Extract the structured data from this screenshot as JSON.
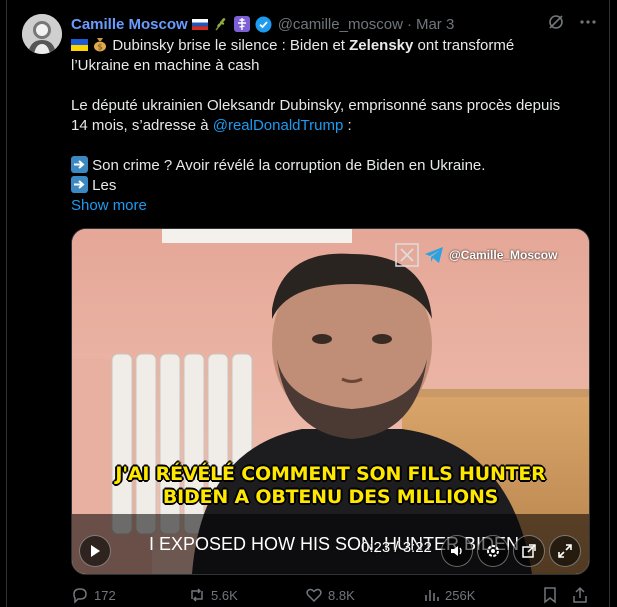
{
  "tweet": {
    "author_name": "Camille Moscow",
    "handle": "@camille_moscow",
    "separator": "·",
    "date": "Mar 3",
    "author_badges": [
      "russia-flag",
      "olive-branch",
      "orthodox-cross",
      "verified-badge"
    ],
    "lines": {
      "l1_a": "Dubinsky brise le silence : Biden et ",
      "l1_bold": "Zelensky",
      "l1_b": " ont transformé",
      "l2": "l’Ukraine en machine à cash",
      "l3": "Le député ukrainien Oleksandr Dubinsky, emprisonné sans procès depuis",
      "l4_a": "14 mois, s’adresse à ",
      "l4_mention": "@realDonaldTrump",
      "l4_b": " :",
      "l5": "Son crime ? Avoir révélé la corruption de Biden en Ukraine.",
      "l6": "Les"
    },
    "show_more": "Show more"
  },
  "video": {
    "watermark": "@Camille_Moscow",
    "subtitle_fr_line1": "J'AI RÉVÉLÉ COMMENT SON FILS HUNTER",
    "subtitle_fr_line2": "BIDEN A OBTENU DES MILLIONS",
    "caption_en": "I EXPOSED HOW HIS SON, HUNTER BIDEN",
    "time": "0:23 / 3:22"
  },
  "actions": {
    "replies": "172",
    "reposts": "5.6K",
    "likes": "8.8K",
    "views": "256K"
  },
  "colors": {
    "background": "#000000",
    "name": "#6a9cff",
    "link": "#1d9bf0",
    "muted": "#71767b",
    "subtitle": "#ffe800"
  }
}
